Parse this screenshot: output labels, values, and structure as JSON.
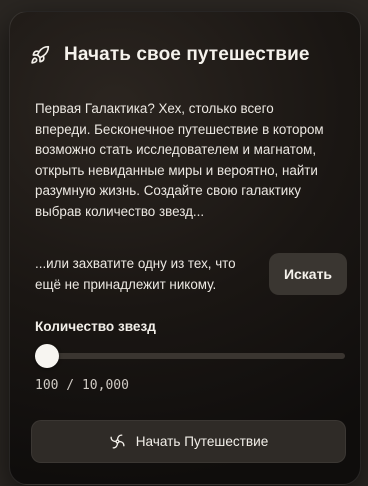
{
  "card": {
    "title": "Начать свое путешествие",
    "title_icon": "rocket-icon",
    "description": "Первая Галактика? Хех, столько всего\nвпереди. Бесконечное путешествие в котором\nвозможно стать исследователем и магнатом,\nоткрыть невиданные миры и вероятно, найти\nразумную жизнь. Создайте свою галактику\nвыбрав количество звезд...",
    "capture_text": "...или захватите одну из тех, что\nещё не принадлежит никому.",
    "search_button_label": "Искать",
    "stars_label": "Количество звезд",
    "stars_value_text": "100 / 10,000",
    "stars_slider": {
      "value": 100,
      "min": 100,
      "max": 10000
    },
    "start_button_label": "Начать Путешествие",
    "start_button_icon": "galaxy-spiral-icon"
  },
  "colors": {
    "page_background": "#2a2622",
    "card_background": "#1a1613",
    "button_background": "#3a3631",
    "text": "#f2efe9",
    "slider_track": "#3a3530",
    "slider_thumb": "#f7f5f1"
  }
}
